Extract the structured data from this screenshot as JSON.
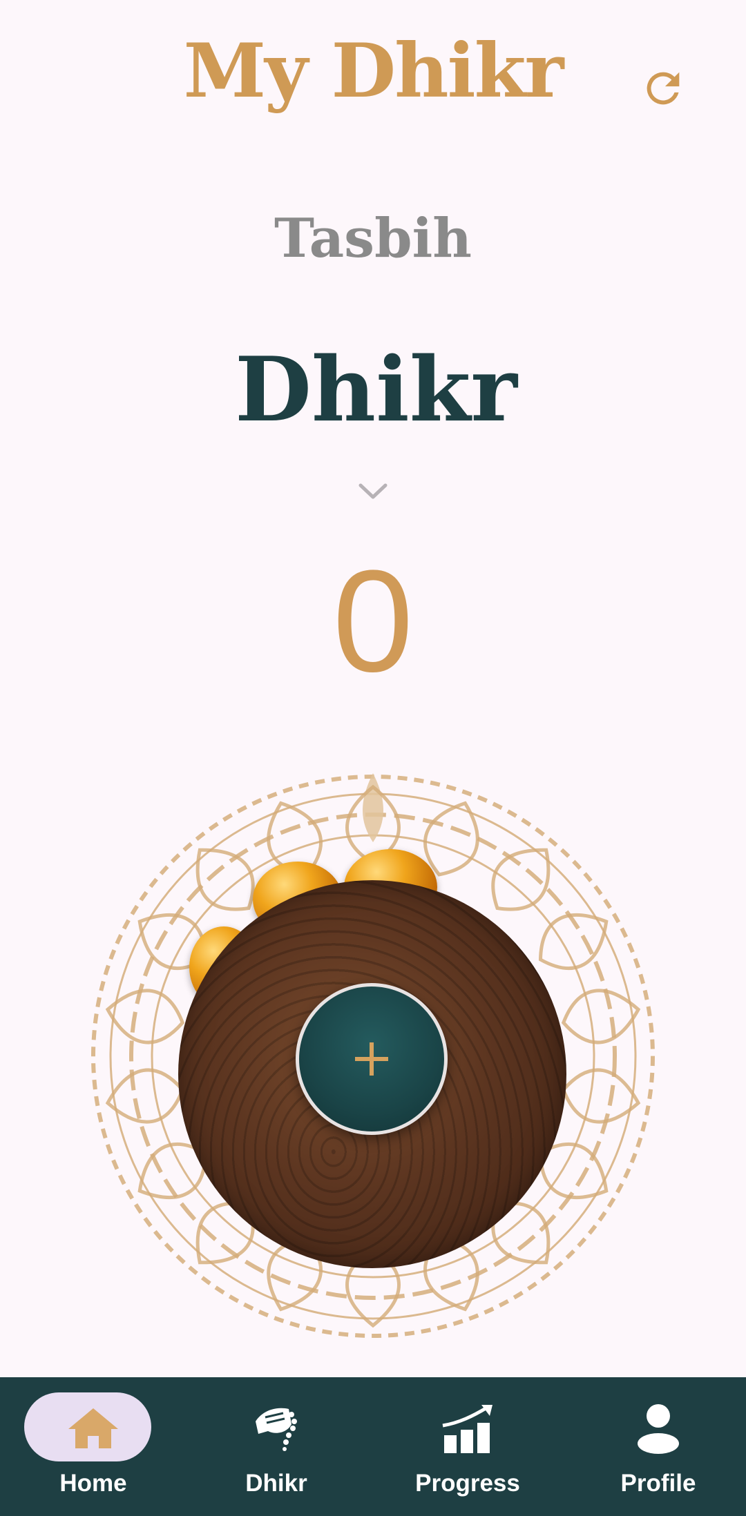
{
  "header": {
    "title": "My Dhikr",
    "refresh_icon": "refresh-icon",
    "accent_color": "#cf9a55"
  },
  "mode_label": "Tasbih",
  "dhikr_selector": {
    "selected": "Dhikr",
    "dropdown_icon": "chevron-down-icon"
  },
  "counter": {
    "value": "0"
  },
  "tap_button": {
    "icon": "plus-icon"
  },
  "bottom_nav": {
    "background": "#1e3f43",
    "items": [
      {
        "label": "Home",
        "icon": "home-icon",
        "active": true
      },
      {
        "label": "Dhikr",
        "icon": "prayer-beads-hand-icon",
        "active": false
      },
      {
        "label": "Progress",
        "icon": "chart-growth-icon",
        "active": false
      },
      {
        "label": "Profile",
        "icon": "person-icon",
        "active": false
      }
    ]
  }
}
